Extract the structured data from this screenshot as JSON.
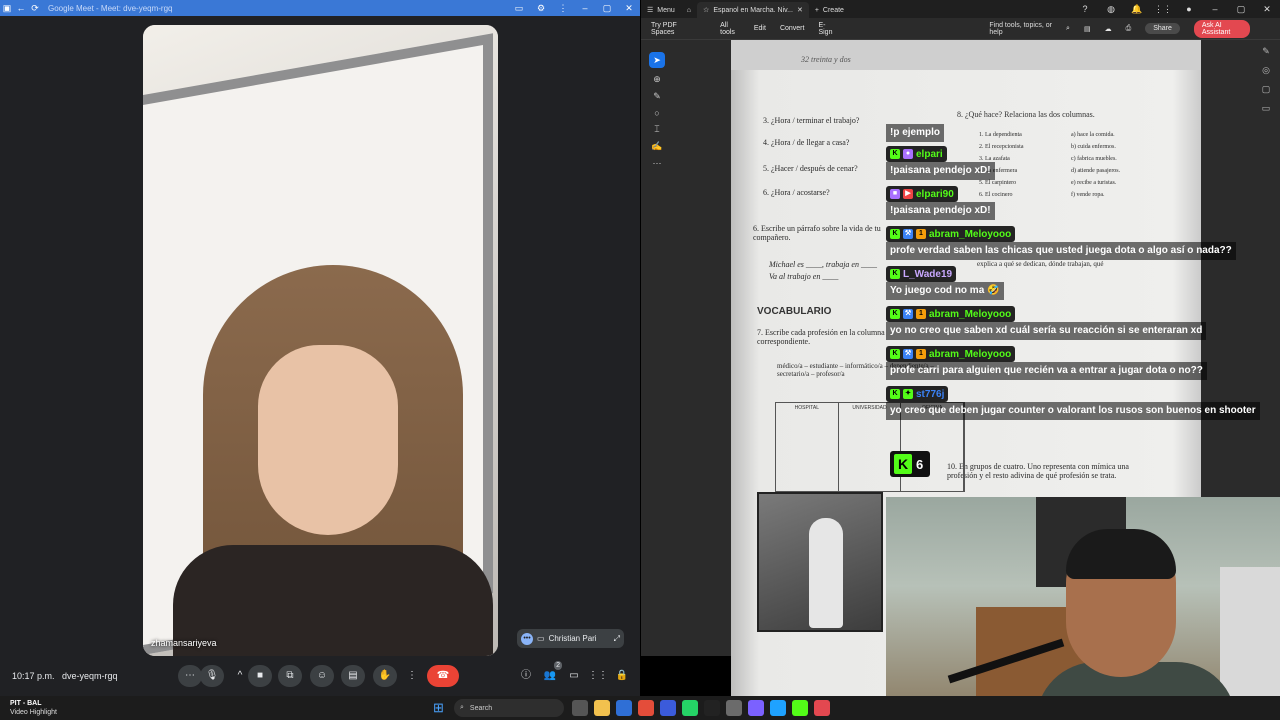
{
  "meet": {
    "window_title": "Google Meet - Meet: dve-yeqm-rgq",
    "participant_name": "zhamansariyeva",
    "pip_name": "Christian Pari",
    "time": "10:17 p.m.",
    "meeting_code": "dve-yeqm-rgq",
    "participants_count": "2"
  },
  "acrobat": {
    "menu": "Menu",
    "tab_title": "Espanol en Marcha. Niv...",
    "create": "Create",
    "try_pdf_spaces": "Try PDF Spaces",
    "toolbar_items": [
      "All tools",
      "Edit",
      "Convert",
      "E-Sign"
    ],
    "find": "Find tools, topics, or help",
    "share": "Share",
    "ask_ai": "Ask AI Assistant",
    "page_header": "32 treinta y dos"
  },
  "pdf": {
    "lines": [
      "3. ¿Hora / terminar el trabajo?",
      "4. ¿Hora / de llegar a casa?",
      "5. ¿Hacer / después de cenar?",
      "6. ¿Hora / acostarse?",
      "8. ¿Qué hace? Relaciona las dos columnas.",
      "1. La dependienta",
      "2. El recepcionista",
      "3. La azafata",
      "4. La enfermera",
      "5. El carpintero",
      "6. El cocinero",
      "a) hace la comida.",
      "b) cuida enfermos.",
      "c) fabrica muebles.",
      "d) atiende pasajeros.",
      "e) recibe a turistas.",
      "f) vende ropa.",
      "6. Escribe un párrafo sobre la vida de tu compañero.",
      "Michael es ____, trabaja en ____",
      "Va al trabajo en ____",
      "explica a qué se dedican, dónde trabajan, qué",
      "VOCABULARIO",
      "7. Escribe cada profesión en la columna correspondiente.",
      "médico/a – estudiante – informático/a – dependiente/a – secretario/a – profesor/a",
      "HOSPITAL",
      "UNIVERSIDAD",
      "OFICINA",
      "10. En grupos de cuatro. Uno representa con mímica una profesión y el resto adivina de qué profesión se trata."
    ]
  },
  "chat": {
    "messages": [
      {
        "user": "",
        "text": "!p ejemplo"
      },
      {
        "user": "elpari",
        "text": "!paisana pendejo xD!"
      },
      {
        "user": "elpari90",
        "text": "!paisana pendejo xD!"
      },
      {
        "user": "abram_Meloyooo",
        "text": "profe verdad saben las chicas que usted juega dota o algo así o nada??"
      },
      {
        "user": "L_Wade19",
        "text": "Yo juego cod no ma 🤣"
      },
      {
        "user": "abram_Meloyooo",
        "text": "yo no creo que saben xd cuál sería su reacción si se enteraran xd"
      },
      {
        "user": "abram_Meloyooo",
        "text": "profe carri para alguien que recién va a entrar a jugar dota o no??"
      },
      {
        "user": "st776j",
        "text": "yo creo que deben jugar counter o valorant los rusos son buenos en shooter"
      }
    ],
    "kick_counter": "6",
    "kick_logo": "K"
  },
  "taskbar": {
    "weather_title": "PIT - BAL",
    "weather_sub": "Video Highlight",
    "search": "Search",
    "notif": "2"
  },
  "colors": {
    "kick_green": "#53fc18",
    "meet_red": "#ea4335",
    "acrobat_red": "#e34850"
  }
}
